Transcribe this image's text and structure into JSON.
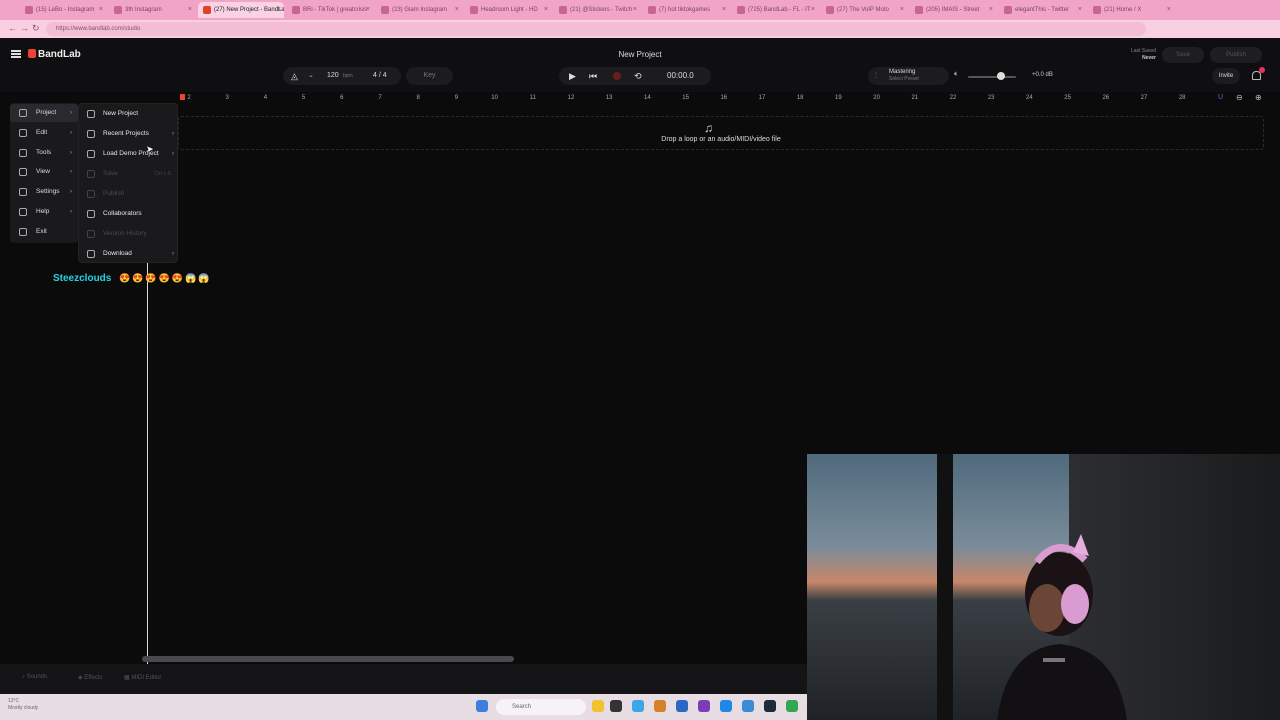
{
  "browser": {
    "tabs": [
      {
        "label": "(15) LeBo - Instagram"
      },
      {
        "label": "3th Instagram"
      },
      {
        "label": "(27) New Project - BandLab",
        "active": true
      },
      {
        "label": "BRi - TikTok | greatcrisis"
      },
      {
        "label": "(23) Glam Instagram"
      },
      {
        "label": "Headroom Light - HD"
      },
      {
        "label": "(21) @Stickers - Twitch"
      },
      {
        "label": "(7) hot tiktokgames"
      },
      {
        "label": "(725) BandLab - FL - IT"
      },
      {
        "label": "(27) The VoIP Moto"
      },
      {
        "label": "(205) IMAIS - Street"
      },
      {
        "label": "elegantThis - Twitter"
      },
      {
        "label": "(21) Home / X"
      }
    ],
    "url": "https://www.bandlab.com/studio"
  },
  "app": {
    "logo": "BandLab",
    "project_title": "New Project",
    "last_saved_label": "Last Saved",
    "last_saved_value": "Never",
    "save_label": "Save",
    "publish_label": "Publish",
    "tempo": "120",
    "tempo_unit": "bpm",
    "time_signature": "4 / 4",
    "key_label": "Key",
    "time_display": "00:00.0",
    "mastering_label": "Mastering",
    "mastering_sub": "Select Preset",
    "volume_db": "+0.0 dB",
    "invite_label": "Invite",
    "ruler_bars": [
      "2",
      "3",
      "4",
      "5",
      "6",
      "7",
      "8",
      "9",
      "10",
      "11",
      "12",
      "13",
      "14",
      "15",
      "16",
      "17",
      "18",
      "19",
      "20",
      "21",
      "22",
      "23",
      "24",
      "25",
      "26",
      "27",
      "28"
    ],
    "drop_text": "Drop a loop or an audio/MIDI/video file",
    "bottom_tabs": [
      "Sounds",
      "Effects",
      "MIDI Editor"
    ]
  },
  "main_menu": [
    {
      "label": "Project",
      "selected": true,
      "chevron": true
    },
    {
      "label": "Edit",
      "chevron": true
    },
    {
      "label": "Tools",
      "chevron": true
    },
    {
      "label": "View",
      "chevron": true
    },
    {
      "label": "Settings",
      "chevron": true
    },
    {
      "label": "Help",
      "chevron": true
    },
    {
      "label": "Exit",
      "chevron": false
    }
  ],
  "project_submenu": [
    {
      "label": "New Project",
      "disabled": false
    },
    {
      "label": "Recent Projects",
      "disabled": false,
      "chevron": true
    },
    {
      "label": "Load Demo Project",
      "disabled": false,
      "chevron": true
    },
    {
      "label": "Save",
      "disabled": true,
      "shortcut": "Ctrl + S"
    },
    {
      "label": "Publish",
      "disabled": true
    },
    {
      "label": "Collaborators",
      "disabled": false
    },
    {
      "label": "Version History",
      "disabled": true
    },
    {
      "label": "Download",
      "disabled": false,
      "chevron": true
    }
  ],
  "chat": {
    "username": "Steezclouds",
    "emojis": "😍😍😍😍😍😱😱"
  },
  "taskbar": {
    "weather_temp": "13°C",
    "weather_desc": "Mostly cloudy",
    "search_placeholder": "Search"
  },
  "colors": {
    "accent": "#f0422e",
    "chat_name": "#24d4e4",
    "tabbar": "#f2a4c8"
  }
}
